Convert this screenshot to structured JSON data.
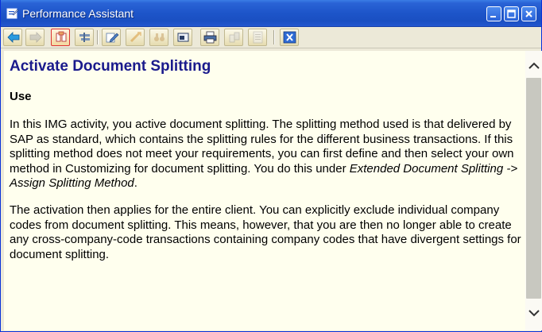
{
  "window": {
    "title": "Performance Assistant"
  },
  "toolbar": {
    "buttons": [
      {
        "name": "back-button",
        "icon": "arrow-left-icon"
      },
      {
        "name": "forward-button",
        "icon": "arrow-right-icon"
      },
      {
        "name": "structure-button",
        "icon": "hierarchy-icon",
        "state": "pressed"
      },
      {
        "name": "technical-info-button",
        "icon": "tools-icon"
      },
      {
        "name": "edit-button",
        "icon": "pencil-icon"
      },
      {
        "name": "link-button",
        "icon": "link-icon",
        "state": "disabled"
      },
      {
        "name": "find-button",
        "icon": "binoculars-icon",
        "state": "disabled"
      },
      {
        "name": "bookmark-button",
        "icon": "bookmark-icon"
      },
      {
        "name": "print-button",
        "icon": "printer-icon"
      },
      {
        "name": "glossary-button",
        "icon": "glossary-icon",
        "state": "disabled"
      },
      {
        "name": "copy-button",
        "icon": "document-icon",
        "state": "disabled"
      },
      {
        "name": "close-doc-button",
        "icon": "close-box-icon"
      }
    ]
  },
  "doc": {
    "heading": "Activate Document Splitting",
    "section_title": "Use",
    "para1_text": "In this IMG activity, you active document splitting.  The splitting method used is that delivered by SAP as standard, which contains the splitting rules for the different  business transactions. If this splitting method does not meet your requirements, you can first define and then select your own method in Customizing for document splitting. You do this under ",
    "para1_path": "Extended Document Splitting -> Assign Splitting Method",
    "para1_end": ".",
    "para2_text": "The activation then applies for the entire client. You can explicitly exclude individual company codes from document splitting. This means, however, that you are then no longer able to create any cross-company-code transactions containing company codes that have divergent settings for document splitting."
  },
  "colors": {
    "title_bar": "#1d55c9",
    "content_background": "#ffffee",
    "heading": "#1a1a8c"
  }
}
